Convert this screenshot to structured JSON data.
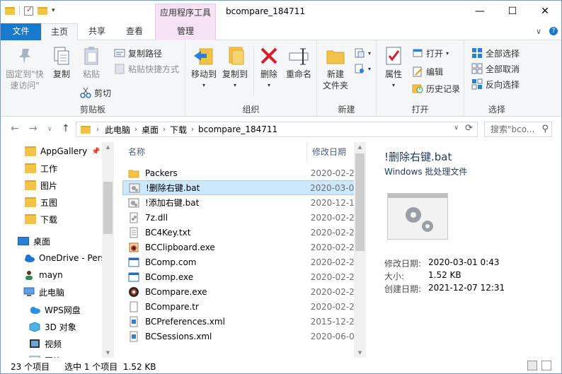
{
  "window": {
    "title": "bcompare_184711",
    "context_tab_title": "应用程序工具",
    "controls": {
      "minimize": "—",
      "maximize": "☐",
      "close": "✕"
    }
  },
  "tabs": {
    "file": "文件",
    "home": "主页",
    "share": "共享",
    "view": "查看",
    "manage": "管理"
  },
  "ribbon": {
    "clipboard": {
      "label": "剪贴板",
      "pin": "固定到\"快速访问\"",
      "copy": "复制",
      "paste": "粘贴",
      "copy_path": "复制路径",
      "paste_shortcut": "粘贴快捷方式",
      "cut": "剪切"
    },
    "organize": {
      "label": "组织",
      "move_to": "移动到",
      "copy_to": "复制到",
      "delete": "删除",
      "rename": "重命名"
    },
    "new": {
      "label": "新建",
      "new_folder": "新建\n文件夹"
    },
    "open": {
      "label": "打开",
      "properties": "属性",
      "open": "打开",
      "edit": "编辑",
      "history": "历史记录"
    },
    "select": {
      "label": "选择",
      "select_all": "全部选择",
      "select_none": "全部取消",
      "invert": "反向选择"
    }
  },
  "address": {
    "crumbs": [
      "此电脑",
      "桌面",
      "下载",
      "bcompare_184711"
    ],
    "search_placeholder": "搜索\"bco...",
    "refresh": "⟳"
  },
  "nav": {
    "items": [
      {
        "label": "AppGallery",
        "icon": "folder-icon"
      },
      {
        "label": "工作",
        "icon": "folder-icon"
      },
      {
        "label": "图片",
        "icon": "folder-icon"
      },
      {
        "label": "五图",
        "icon": "folder-icon"
      },
      {
        "label": "下载",
        "icon": "folder-icon"
      },
      {
        "label": "桌面",
        "icon": "desktop-icon"
      },
      {
        "label": "OneDrive - Pers",
        "icon": "onedrive-icon"
      },
      {
        "label": "mayn",
        "icon": "user-icon"
      },
      {
        "label": "此电脑",
        "icon": "computer-icon"
      },
      {
        "label": "WPS网盘",
        "icon": "cloud-icon"
      },
      {
        "label": "3D 对象",
        "icon": "cube-icon"
      },
      {
        "label": "视频",
        "icon": "video-icon"
      },
      {
        "label": "图片",
        "icon": "picture-icon"
      }
    ]
  },
  "files": {
    "col_name": "名称",
    "col_date": "修改日期",
    "rows": [
      {
        "name": "Packers",
        "date": "2020-02-2",
        "icon": "folder-icon"
      },
      {
        "name": "!删除右键.bat",
        "date": "2020-03-0",
        "icon": "bat-icon",
        "selected": true
      },
      {
        "name": "!添加右键.bat",
        "date": "2020-12-1",
        "icon": "bat-icon"
      },
      {
        "name": "7z.dll",
        "date": "2020-02-2",
        "icon": "dll-icon"
      },
      {
        "name": "BC4Key.txt",
        "date": "2020-02-2",
        "icon": "txt-icon"
      },
      {
        "name": "BCClipboard.exe",
        "date": "2020-02-2",
        "icon": "exe-icon"
      },
      {
        "name": "BComp.com",
        "date": "2020-02-2",
        "icon": "com-icon"
      },
      {
        "name": "BComp.exe",
        "date": "2020-02-2",
        "icon": "com-icon"
      },
      {
        "name": "BCompare.exe",
        "date": "2020-02-2",
        "icon": "bcompare-icon"
      },
      {
        "name": "BCompare.tr",
        "date": "2020-02-2",
        "icon": "file-icon"
      },
      {
        "name": "BCPreferences.xml",
        "date": "2015-12-2",
        "icon": "xml-icon"
      },
      {
        "name": "BCSessions.xml",
        "date": "2020-06-0",
        "icon": "xml-icon"
      }
    ]
  },
  "preview": {
    "title": "!删除右键.bat",
    "subtitle": "Windows 批处理文件",
    "modified_label": "修改日期:",
    "modified_value": "2020-03-01 0:43",
    "size_label": "大小:",
    "size_value": "1.52 KB",
    "created_label": "创建日期:",
    "created_value": "2021-12-07 12:31"
  },
  "status": {
    "count": "23 个项目",
    "selected": "选中 1 个项目  1.52 KB"
  }
}
